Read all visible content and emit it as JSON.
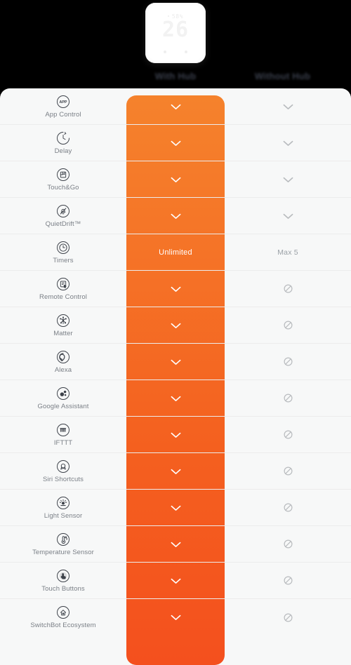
{
  "device": {
    "humidity": "58%",
    "temperature": "26",
    "name": "smart-thermostat"
  },
  "columns": {
    "feature_header": "",
    "with_hub": "With Hub",
    "without_hub": "Without Hub"
  },
  "colors": {
    "accent_top": "#F5822C",
    "accent_bottom": "#F4501E",
    "panel_bg": "#F7F8F8",
    "page_bg": "#000000",
    "label_text": "#7A7F86",
    "muted_mark": "#B9BCBF"
  },
  "marks": {
    "check": "check-icon",
    "blocked": "prohibited-icon"
  },
  "rows": [
    {
      "icon": "app-control-icon",
      "label": "App Control",
      "with": "check",
      "without": "check"
    },
    {
      "icon": "delay-icon",
      "label": "Delay",
      "with": "check",
      "without": "check"
    },
    {
      "icon": "touch-and-go-icon",
      "label": "Touch&Go",
      "with": "check",
      "without": "check"
    },
    {
      "icon": "quietdrift-icon",
      "label": "QuietDrift™",
      "with": "check",
      "without": "check"
    },
    {
      "icon": "timers-icon",
      "label": "Timers",
      "with": "Unlimited",
      "without": "Max 5"
    },
    {
      "icon": "remote-control-icon",
      "label": "Remote Control",
      "with": "check",
      "without": "blocked"
    },
    {
      "icon": "matter-icon",
      "label": "Matter",
      "with": "check",
      "without": "blocked"
    },
    {
      "icon": "alexa-icon",
      "label": "Alexa",
      "with": "check",
      "without": "blocked"
    },
    {
      "icon": "google-assistant-icon",
      "label": "Google Assistant",
      "with": "check",
      "without": "blocked"
    },
    {
      "icon": "ifttt-icon",
      "label": "IFTTT",
      "with": "check",
      "without": "blocked"
    },
    {
      "icon": "siri-shortcuts-icon",
      "label": "Siri Shortcuts",
      "with": "check",
      "without": "blocked"
    },
    {
      "icon": "light-sensor-icon",
      "label": "Light Sensor",
      "with": "check",
      "without": "blocked"
    },
    {
      "icon": "temperature-sensor-icon",
      "label": "Temperature Sensor",
      "with": "check",
      "without": "blocked"
    },
    {
      "icon": "touch-buttons-icon",
      "label": "Touch Buttons",
      "with": "check",
      "without": "blocked"
    },
    {
      "icon": "switchbot-ecosystem-icon",
      "label": "SwitchBot Ecosystem",
      "with": "check",
      "without": "blocked"
    }
  ]
}
